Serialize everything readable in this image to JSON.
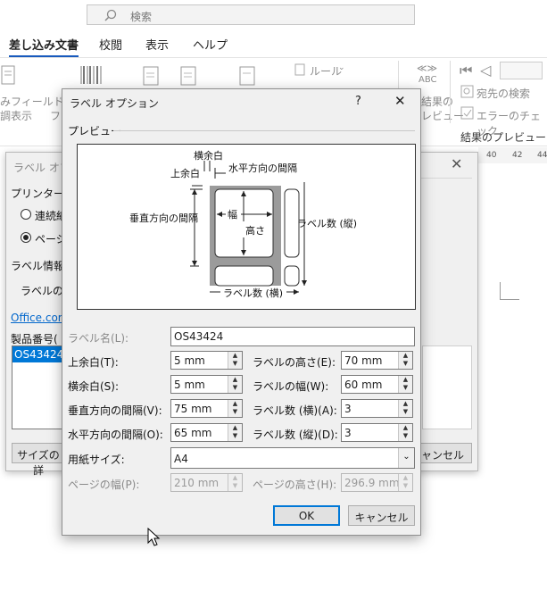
{
  "ribbon": {
    "search_placeholder": "検索",
    "tabs": [
      "差し込み文書",
      "校閲",
      "表示",
      "ヘルプ"
    ],
    "rules_label": "ルール",
    "field_label_1": "みフィールド",
    "field_label_2": "調表示",
    "field_label_3": "フィ",
    "abc_label": "ABC",
    "results_1": "結果の",
    "results_2": "レビュー",
    "find_recipient": "宛先の検索",
    "error_check": "エラーのチェック",
    "group_preview_results": "結果のプレビュー",
    "ruler_numbers": [
      "40",
      "42",
      "44"
    ]
  },
  "back_dialog": {
    "title": "ラベル オプシ",
    "printer_label": "プリンター",
    "radio_continuous": "連続紙",
    "radio_page": "ページ",
    "label_info": "ラベル情報",
    "label_maker": "ラベルの製",
    "office_link": "Office.com",
    "product_number": "製品番号(",
    "list_selected": "OS43424",
    "size_button": "サイズの詳",
    "cancel_button": "キャンセル"
  },
  "dialog": {
    "title": "ラベル オプション",
    "help": "?",
    "close": "✕",
    "preview_group": "プレビュー",
    "preview": {
      "side_margin": "横余白",
      "top_margin": "上余白",
      "horizontal_pitch": "水平方向の間隔",
      "vertical_pitch": "垂直方向の間隔",
      "width": "幅",
      "height": "高さ",
      "number_down": "ラベル数 (縦)",
      "number_across": "ラベル数 (横)"
    },
    "label_name_label": "ラベル名(L):",
    "label_name_value": "OS43424",
    "top_margin_label": "上余白(T):",
    "top_margin_value": "5 mm",
    "label_height_label": "ラベルの高さ(E):",
    "label_height_value": "70 mm",
    "side_margin_label": "横余白(S):",
    "side_margin_value": "5 mm",
    "label_width_label": "ラベルの幅(W):",
    "label_width_value": "60 mm",
    "vertical_pitch_label": "垂直方向の間隔(V):",
    "vertical_pitch_value": "75 mm",
    "number_across_label": "ラベル数 (横)(A):",
    "number_across_value": "3",
    "horizontal_pitch_label": "水平方向の間隔(O):",
    "horizontal_pitch_value": "65 mm",
    "number_down_label": "ラベル数 (縦)(D):",
    "number_down_value": "3",
    "page_size_label": "用紙サイズ:",
    "page_size_value": "A4",
    "page_width_label": "ページの幅(P):",
    "page_width_value": "210 mm",
    "page_height_label": "ページの高さ(H):",
    "page_height_value": "296.9 mm",
    "ok": "OK",
    "cancel": "キャンセル"
  }
}
